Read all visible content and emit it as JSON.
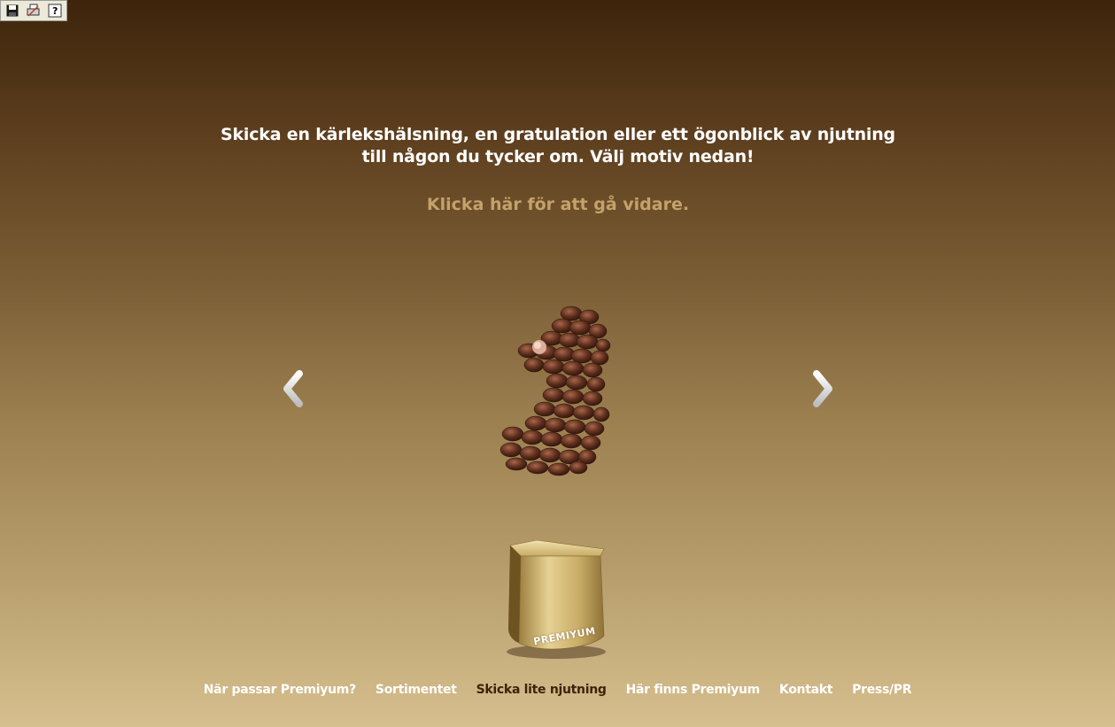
{
  "toolbar": {
    "buttons": [
      {
        "icon": "save-icon"
      },
      {
        "icon": "print-icon"
      },
      {
        "icon": "help-icon"
      }
    ]
  },
  "main": {
    "headline_line1": "Skicka en kärlekshälsning, en gratulation eller ett ögonblick av njutning",
    "headline_line2": "till någon du tycker om. Välj motiv nedan!",
    "cta": "Klicka här för att gå vidare.",
    "prev_icon": "chevron-left-icon",
    "next_icon": "chevron-right-icon"
  },
  "product": {
    "brand": "PREMIYUM"
  },
  "nav": {
    "items": [
      {
        "label": "När passar Premiyum?",
        "active": false
      },
      {
        "label": "Sortimentet",
        "active": false
      },
      {
        "label": "Skicka lite njutning",
        "active": true
      },
      {
        "label": "Här finns Premiyum",
        "active": false
      },
      {
        "label": "Kontakt",
        "active": false
      },
      {
        "label": "Press/PR",
        "active": false
      }
    ]
  },
  "colors": {
    "headline": "#ffffff",
    "cta": "#c4a26a",
    "nav_active": "#3d2408",
    "bg_top": "#3d240a",
    "bg_bottom": "#d6bf8e"
  }
}
